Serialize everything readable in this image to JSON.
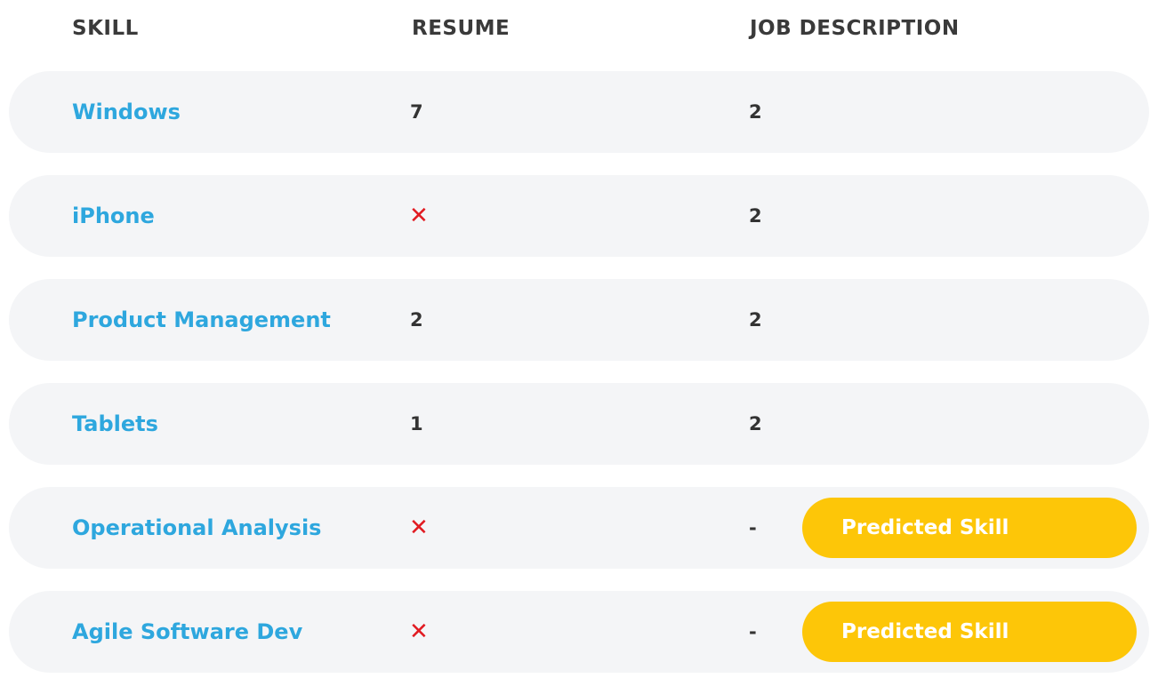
{
  "header": {
    "skill_label": "SKILL",
    "resume_label": "RESUME",
    "jd_label": "JOB DESCRIPTION"
  },
  "rows": [
    {
      "skill": "Windows",
      "resume": "7",
      "resume_missing": false,
      "jd": "2",
      "badge": ""
    },
    {
      "skill": "iPhone",
      "resume": "✕",
      "resume_missing": true,
      "jd": "2",
      "badge": ""
    },
    {
      "skill": "Product Management",
      "resume": "2",
      "resume_missing": false,
      "jd": "2",
      "badge": ""
    },
    {
      "skill": "Tablets",
      "resume": "1",
      "resume_missing": false,
      "jd": "2",
      "badge": ""
    },
    {
      "skill": "Operational Analysis",
      "resume": "✕",
      "resume_missing": true,
      "jd": "-",
      "badge": "Predicted Skill"
    },
    {
      "skill": "Agile Software Dev",
      "resume": "✕",
      "resume_missing": true,
      "jd": "-",
      "badge": "Predicted Skill"
    }
  ],
  "colors": {
    "skill_link": "#2ea7de",
    "missing_mark": "#e11b22",
    "badge_bg": "#fdc608",
    "row_bg": "#f4f5f7"
  }
}
